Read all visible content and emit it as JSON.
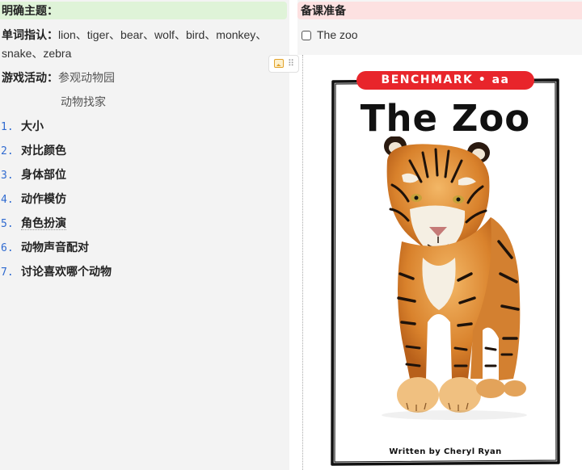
{
  "left": {
    "header": "明确主题：",
    "vocab_label": "单词指认：",
    "vocab_words": "lion、tiger、bear、wolf、bird、monkey、snake、zebra",
    "activity_label": "游戏活动：",
    "activity_value": "参观动物园",
    "activity_sub": "动物找家",
    "list": [
      {
        "num": "1.",
        "text": "大小"
      },
      {
        "num": "2.",
        "text": "对比颜色"
      },
      {
        "num": "3.",
        "text": "身体部位"
      },
      {
        "num": "4.",
        "text": "动作模仿"
      },
      {
        "num": "5.",
        "text": "角色扮演"
      },
      {
        "num": "6.",
        "text": "动物声音配对"
      },
      {
        "num": "7.",
        "text": "讨论喜欢哪个动物"
      }
    ]
  },
  "right": {
    "header": "备课准备",
    "todo_label": "The zoo",
    "todo_checked": false,
    "book": {
      "badge": "BENCHMARK • aa",
      "title": "The Zoo",
      "author": "Written by Cheryl Ryan"
    }
  },
  "toolbar": {
    "image_icon": "image-icon",
    "drag_icon": "drag-handle-icon",
    "drag_glyph": "⠿"
  },
  "colors": {
    "left_header_bg": "#dff3d8",
    "right_header_bg": "#fde1e1",
    "list_number": "#2f6ad0",
    "badge_red": "#e8252b"
  }
}
